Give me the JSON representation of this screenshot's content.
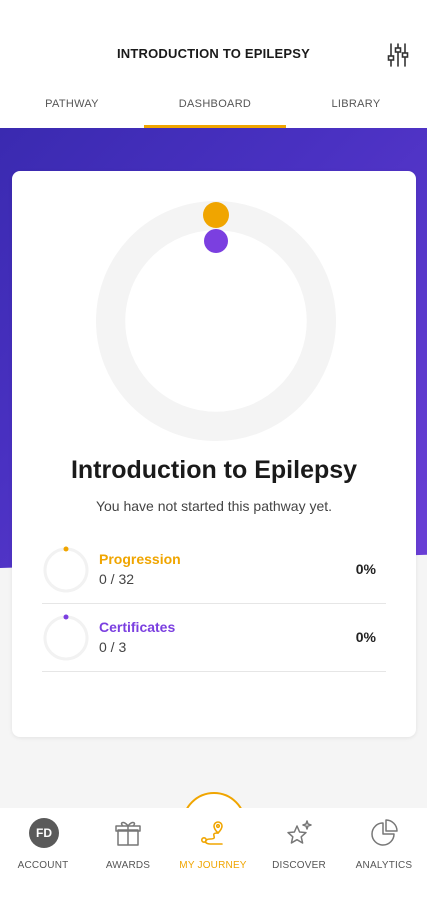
{
  "header": {
    "title": "INTRODUCTION TO EPILEPSY",
    "filter_icon": "sliders-icon"
  },
  "tabs": [
    {
      "label": "PATHWAY",
      "active": false
    },
    {
      "label": "DASHBOARD",
      "active": true
    },
    {
      "label": "LIBRARY",
      "active": false
    }
  ],
  "card": {
    "title": "Introduction to Epilepsy",
    "subtitle": "You have not started this pathway yet.",
    "stats": [
      {
        "label": "Progression",
        "count": "0 / 32",
        "percent": "0%",
        "progress": 0,
        "color": "#f0a500"
      },
      {
        "label": "Certificates",
        "count": "0 / 3",
        "percent": "0%",
        "progress": 0,
        "color": "#7b3fe0"
      }
    ]
  },
  "nav": [
    {
      "label": "ACCOUNT",
      "icon": "avatar",
      "avatar_initials": "FD",
      "active": false
    },
    {
      "label": "AWARDS",
      "icon": "gift-icon",
      "active": false
    },
    {
      "label": "MY JOURNEY",
      "icon": "journey-icon",
      "active": true
    },
    {
      "label": "DISCOVER",
      "icon": "star-icon",
      "active": false
    },
    {
      "label": "ANALYTICS",
      "icon": "pie-chart-icon",
      "active": false
    }
  ],
  "colors": {
    "accent": "#f0a500",
    "purple": "#7b3fe0",
    "gradient_start": "#3a2ab0",
    "gradient_end": "#6a3fd6"
  }
}
